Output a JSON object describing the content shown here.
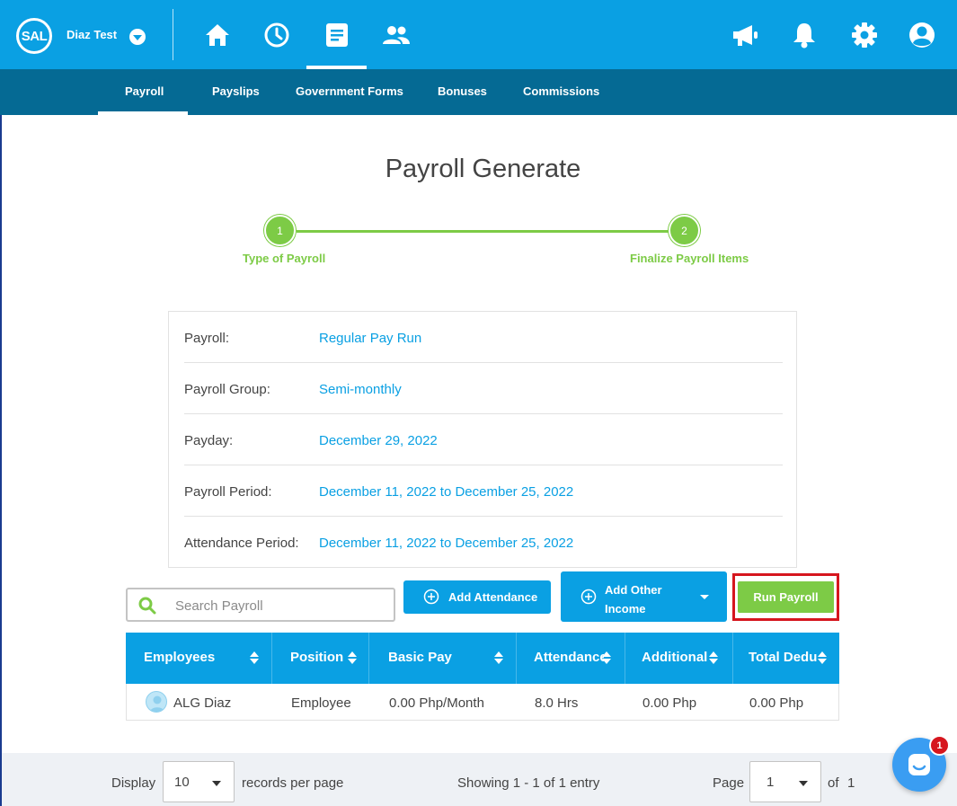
{
  "header": {
    "logo_text": "SAL",
    "company": "Diaz Test"
  },
  "subnav": {
    "items": [
      "Payroll",
      "Payslips",
      "Government Forms",
      "Bonuses",
      "Commissions"
    ]
  },
  "page": {
    "title": "Payroll Generate"
  },
  "stepper": {
    "steps": [
      {
        "number": "1",
        "label": "Type of Payroll"
      },
      {
        "number": "2",
        "label": "Finalize Payroll Items"
      }
    ]
  },
  "info": {
    "rows": [
      {
        "label": "Payroll:",
        "value": "Regular Pay Run"
      },
      {
        "label": "Payroll Group:",
        "value": "Semi-monthly"
      },
      {
        "label": "Payday:",
        "value": "December 29, 2022"
      },
      {
        "label": "Payroll Period:",
        "value": "December 11, 2022 to December 25, 2022"
      },
      {
        "label": "Attendance Period:",
        "value": "December 11, 2022 to December 25, 2022"
      }
    ]
  },
  "toolbar": {
    "search_placeholder": "Search Payroll",
    "add_attendance": "Add Attendance",
    "add_other_income_line1": "Add Other",
    "add_other_income_line2": "Income",
    "run_payroll": "Run Payroll"
  },
  "table": {
    "columns": [
      "Employees",
      "Position",
      "Basic Pay",
      "Attendance",
      "Additional",
      "Total Dedu"
    ],
    "rows": [
      {
        "employee": "ALG Diaz",
        "position": "Employee",
        "basic_pay": "0.00 Php/Month",
        "attendance": "8.0 Hrs",
        "additional": "0.00 Php",
        "total_deductions": "0.00 Php"
      }
    ]
  },
  "footer": {
    "display_label": "Display",
    "per_page_value": "10",
    "records_label": "records per page",
    "showing": "Showing 1 - 1 of 1 entry",
    "page_label": "Page",
    "page_value": "1",
    "of_label": "of",
    "total_pages": "1"
  },
  "chat": {
    "badge_count": "1"
  },
  "colors": {
    "primary": "#0aa0e3",
    "subnav": "#056a94",
    "success": "#7dcb46",
    "highlight": "#d6161e"
  }
}
